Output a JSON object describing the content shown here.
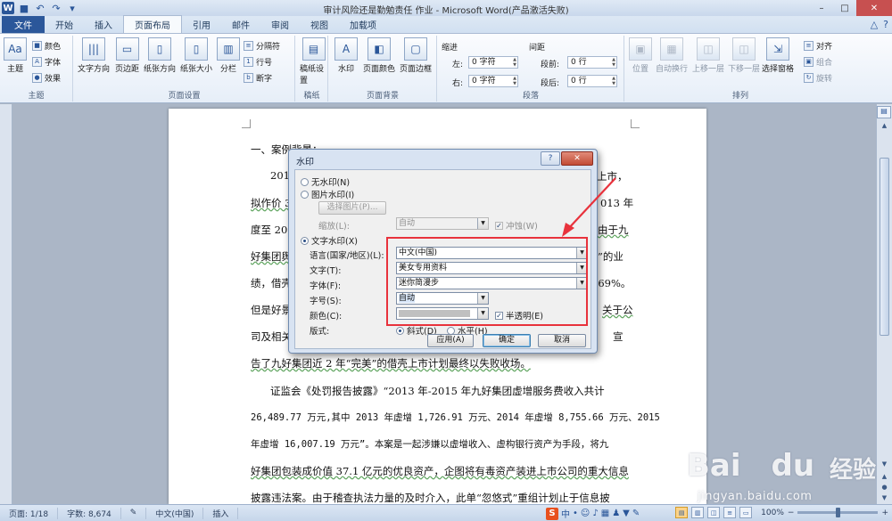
{
  "window": {
    "title": "审计风险还是勤勉责任 作业 - Microsoft Word(产品激活失败)",
    "controls": [
      "–",
      "□",
      "✕"
    ]
  },
  "tabs": [
    "文件",
    "开始",
    "插入",
    "页面布局",
    "引用",
    "邮件",
    "审阅",
    "视图",
    "加载项"
  ],
  "active_tab": "页面布局",
  "ribbon": {
    "theme_group": {
      "label": "主题",
      "big": "主题",
      "small": [
        "颜色",
        "字体",
        "效果"
      ]
    },
    "page_setup_group": {
      "label": "页面设置",
      "big": [
        "文字方向",
        "页边距",
        "纸张方向",
        "纸张大小",
        "分栏"
      ],
      "small": [
        "分隔符",
        "行号",
        "断字"
      ]
    },
    "draft_group": {
      "label": "稿纸",
      "big": [
        "稿纸设置"
      ]
    },
    "page_bg_group": {
      "label": "页面背景",
      "big": [
        "水印",
        "页面颜色",
        "页面边框"
      ]
    },
    "paragraph_group": {
      "label": "段落",
      "indent_title": "缩进",
      "spacing_title": "间距",
      "indent_left_label": "左:",
      "indent_left_value": "0 字符",
      "indent_right_label": "右:",
      "indent_right_value": "0 字符",
      "spacing_before_label": "段前:",
      "spacing_before_value": "0 行",
      "spacing_after_label": "段后:",
      "spacing_after_value": "0 行"
    },
    "arrange_group": {
      "label": "排列",
      "big": [
        "位置",
        "自动换行",
        "上移一层",
        "下移一层",
        "选择窗格"
      ],
      "small": [
        "对齐",
        "组合",
        "旋转"
      ]
    }
  },
  "document": {
    "lines": [
      "一、案例背景：",
      "2015",
      "上市，",
      "拟作价 3",
      "013 年",
      "度至 201",
      "由于九",
      "好集团舆",
      "”的业",
      "绩，借壳",
      "269%。",
      "但是好景",
      "关于公",
      "司及相关",
      "宣",
      "告了九好集团近 2 年“完美”的借壳上市计划最终以失败收场。",
      "证监会《处罚报告披露》“2013 年-2015 年九好集团虚增服务费收入共计",
      "26,489.77 万元,其中 2013 年虚增 1,726.91 万元、2014 年虚增 8,755.66 万元、2015",
      "年虚增 16,007.19 万元”。本案是一起涉嫌以虚增收入、虚构银行资产为手段，将九",
      "好集团包装成价值 37.1 亿元的优良资产，企图将有毒资产装进上市公司的重大信息",
      "披露违法案。由于稽查执法力量的及时介入，此单“忽悠式”重组计划止于信息披"
    ]
  },
  "dialog": {
    "title": "水印",
    "help": "?",
    "close": "✕",
    "no_watermark": "无水印(N)",
    "picture_watermark": "图片水印(I)",
    "select_picture": "选择图片(P)...",
    "scale_label": "缩放(L):",
    "scale_value": "自动",
    "washout_label": "冲蚀(W)",
    "text_watermark": "文字水印(X)",
    "language_label": "语言(国家/地区)(L):",
    "language_value": "中文(中国)",
    "text_label": "文字(T):",
    "text_value": "美女专用资料",
    "font_label": "字体(F):",
    "font_value": "迷你简漫步",
    "size_label": "字号(S):",
    "size_value": "自动",
    "color_label": "颜色(C):",
    "semi_transparent_label": "半透明(E)",
    "layout_label": "版式:",
    "diagonal_label": "斜式(D)",
    "horizontal_label": "水平(H)",
    "apply_button": "应用(A)",
    "ok_button": "确定",
    "cancel_button": "取消"
  },
  "statusbar": {
    "page": "页面: 1/18",
    "words": "字数: 8,674",
    "language": "中文(中国)",
    "mode": "插入",
    "ime": "中",
    "zoom": "100%"
  },
  "watermark": {
    "brand": "Bai",
    "brand2": "du",
    "suffix": "经验",
    "url": "jingyan.baidu.com"
  },
  "colors": {
    "annotation": "#e8323c",
    "file_tab": "#2b579a"
  }
}
